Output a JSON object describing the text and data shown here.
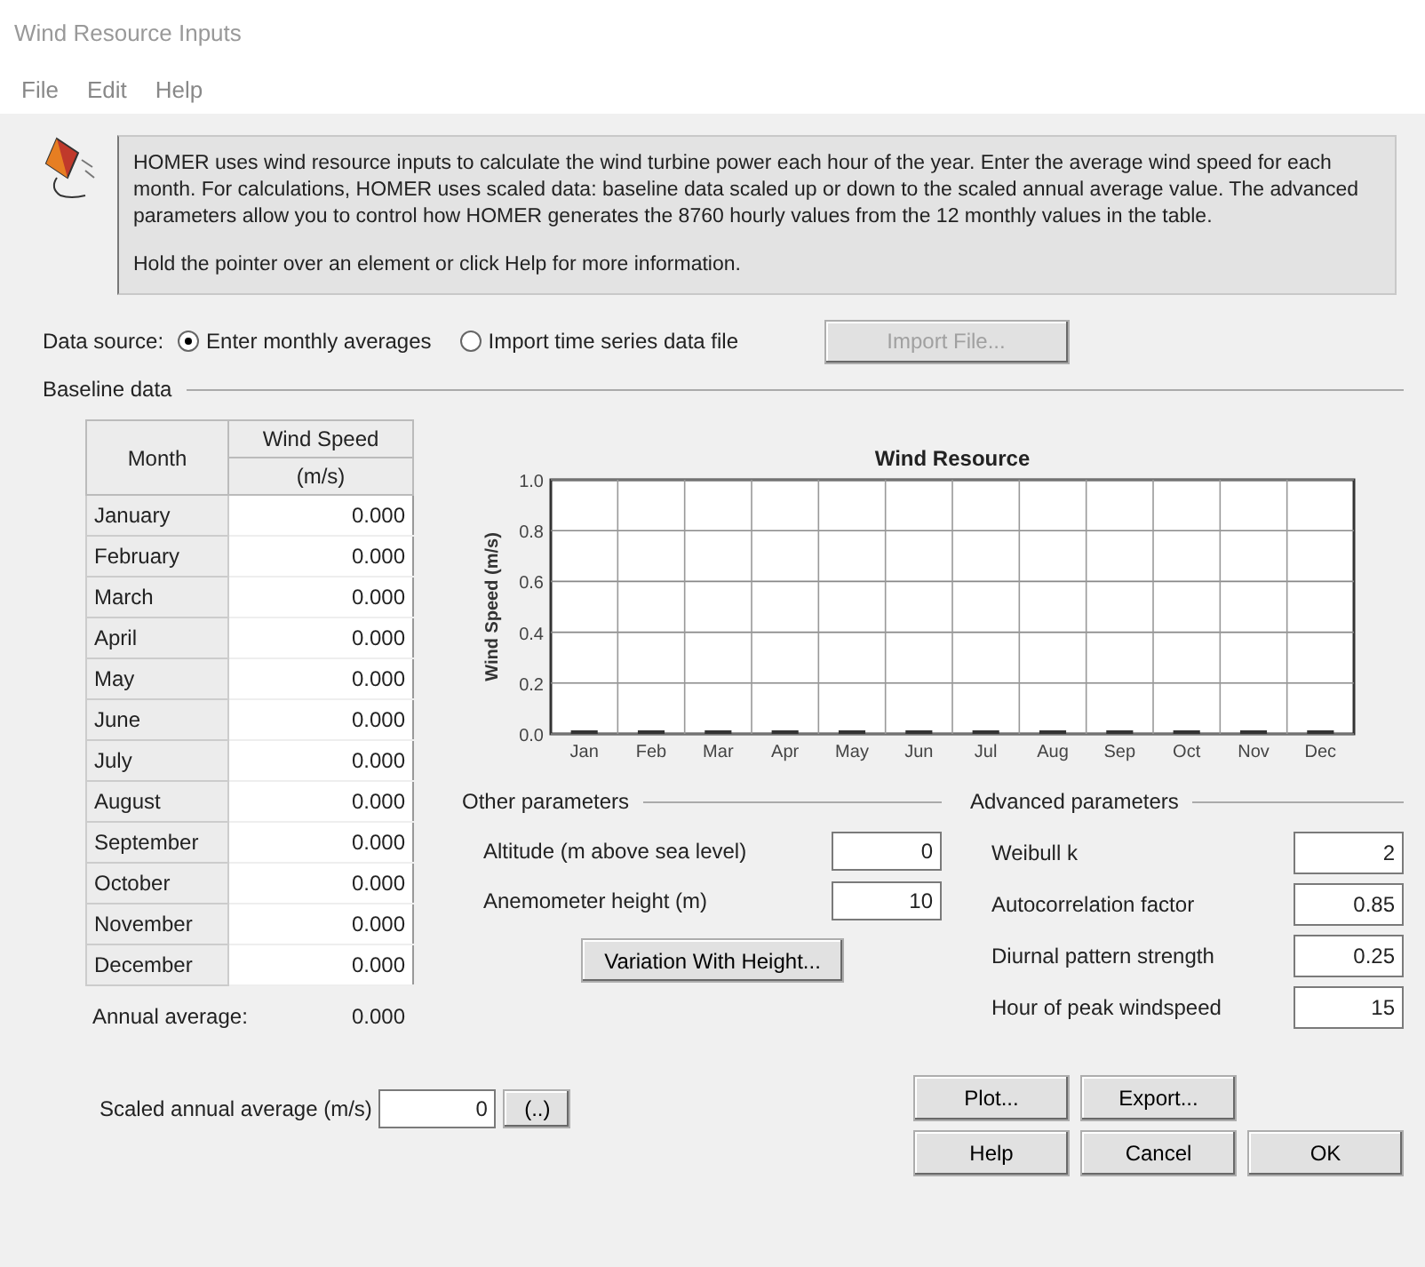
{
  "window": {
    "title": "Wind Resource Inputs"
  },
  "menu": [
    "File",
    "Edit",
    "Help"
  ],
  "info": {
    "paragraphs": [
      "HOMER uses wind resource inputs to calculate the wind turbine power each hour of the year. Enter the average wind speed for each month. For calculations, HOMER uses scaled data: baseline data scaled up or down to the scaled annual average value. The advanced parameters allow you to control how HOMER generates the 8760 hourly values from the 12 monthly values in the table.",
      "Hold the pointer over an element or click Help for more information."
    ]
  },
  "data_source": {
    "label": "Data source:",
    "options": [
      {
        "label": "Enter monthly averages",
        "selected": true
      },
      {
        "label": "Import time series data file",
        "selected": false
      }
    ],
    "import_button": {
      "label": "Import File...",
      "disabled": true
    }
  },
  "baseline": {
    "title": "Baseline data",
    "columns": [
      "Month",
      "Wind Speed",
      "(m/s)"
    ],
    "rows": [
      {
        "month": "January",
        "speed": "0.000"
      },
      {
        "month": "February",
        "speed": "0.000"
      },
      {
        "month": "March",
        "speed": "0.000"
      },
      {
        "month": "April",
        "speed": "0.000"
      },
      {
        "month": "May",
        "speed": "0.000"
      },
      {
        "month": "June",
        "speed": "0.000"
      },
      {
        "month": "July",
        "speed": "0.000"
      },
      {
        "month": "August",
        "speed": "0.000"
      },
      {
        "month": "September",
        "speed": "0.000"
      },
      {
        "month": "October",
        "speed": "0.000"
      },
      {
        "month": "November",
        "speed": "0.000"
      },
      {
        "month": "December",
        "speed": "0.000"
      }
    ],
    "annual_label": "Annual average:",
    "annual_value": "0.000",
    "chart_data": {
      "type": "bar",
      "grid": true,
      "title": "Wind Resource",
      "ylabel": "Wind Speed (m/s)",
      "categories": [
        "Jan",
        "Feb",
        "Mar",
        "Apr",
        "May",
        "Jun",
        "Jul",
        "Aug",
        "Sep",
        "Oct",
        "Nov",
        "Dec"
      ],
      "values": [
        0,
        0,
        0,
        0,
        0,
        0,
        0,
        0,
        0,
        0,
        0,
        0
      ],
      "ylim": [
        0,
        1
      ],
      "yticks": [
        {
          "value": 0,
          "label": "0.0"
        },
        {
          "value": 0.2,
          "label": "0.2"
        },
        {
          "value": 0.4,
          "label": "0.4"
        },
        {
          "value": 0.6,
          "label": "0.6"
        },
        {
          "value": 0.8,
          "label": "0.8"
        },
        {
          "value": 1,
          "label": "1.0"
        }
      ]
    }
  },
  "other_parameters": {
    "title": "Other parameters",
    "fields": [
      {
        "label": "Altitude (m above sea level)",
        "value": "0"
      },
      {
        "label": "Anemometer height (m)",
        "value": "10"
      }
    ],
    "button": "Variation With Height..."
  },
  "advanced_parameters": {
    "title": "Advanced parameters",
    "fields": [
      {
        "label": "Weibull k",
        "value": "2"
      },
      {
        "label": "Autocorrelation factor",
        "value": "0.85"
      },
      {
        "label": "Diurnal pattern strength",
        "value": "0.25"
      },
      {
        "label": "Hour of peak windspeed",
        "value": "15"
      }
    ]
  },
  "scaled": {
    "label": "Scaled annual average (m/s)",
    "value": "0",
    "button": "(..)"
  },
  "buttons": [
    [
      "Plot...",
      "Export..."
    ],
    [
      "Help",
      "Cancel",
      "OK"
    ]
  ]
}
